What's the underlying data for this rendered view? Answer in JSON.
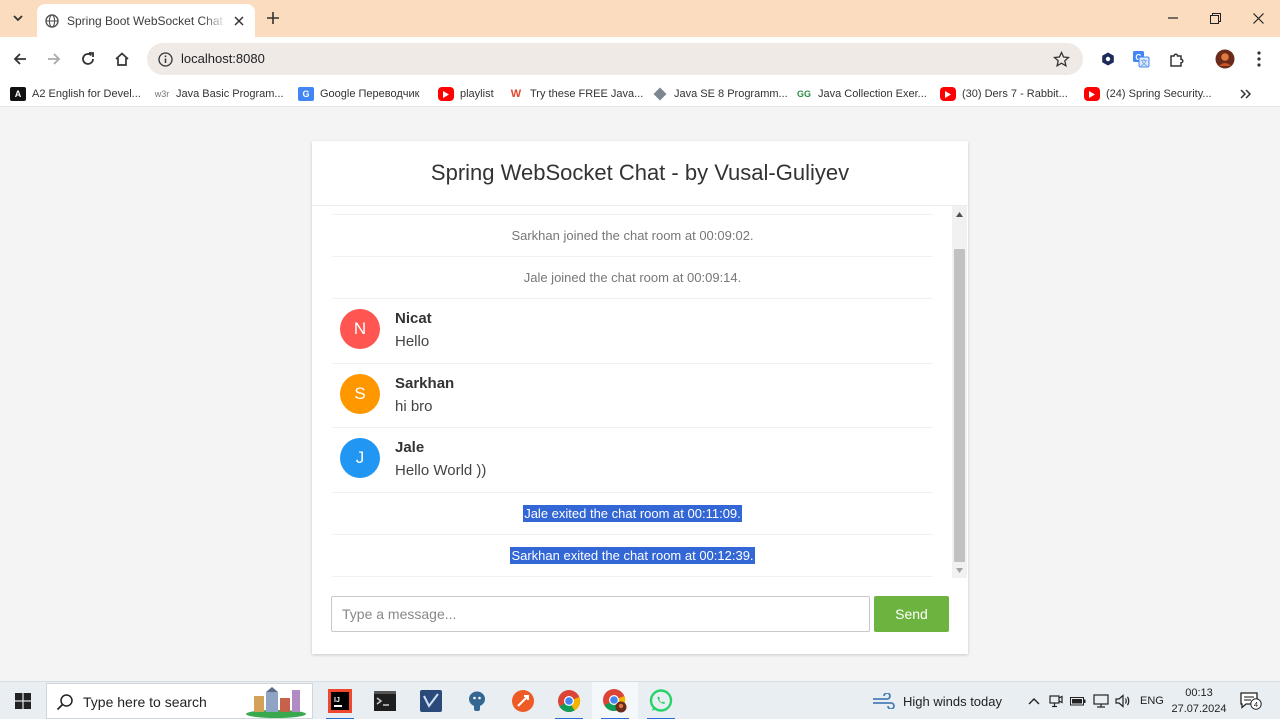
{
  "browser": {
    "tab": {
      "title": "Spring Boot WebSocket Chat Application",
      "favicon": "globe-icon"
    },
    "url": "localhost:8080",
    "bookmarks": [
      {
        "label": "A2 English for Devel...",
        "icon": "a2-icon"
      },
      {
        "label": "Java Basic Program...",
        "icon": "w3r-icon"
      },
      {
        "label": "Google Переводчик",
        "icon": "translate-icon"
      },
      {
        "label": "playlist",
        "icon": "youtube-icon"
      },
      {
        "label": "Try these FREE Java...",
        "icon": "w-logo-icon"
      },
      {
        "label": "Java SE 8 Programm...",
        "icon": "diamond-icon"
      },
      {
        "label": "Java Collection Exer...",
        "icon": "gfg-icon"
      },
      {
        "label": "(30) Ders 7 - Rabbit...",
        "icon": "youtube-icon"
      },
      {
        "label": "(24) Spring Security...",
        "icon": "youtube-icon"
      }
    ]
  },
  "chat": {
    "title": "Spring WebSocket Chat - by Vusal-Guliyev",
    "events_top": [
      "Sarkhan joined the chat room at 00:09:02.",
      "Jale joined the chat room at 00:09:14."
    ],
    "messages": [
      {
        "initial": "N",
        "sender": "Nicat",
        "text": "Hello",
        "color": "#ff5652"
      },
      {
        "initial": "S",
        "sender": "Sarkhan",
        "text": "hi bro",
        "color": "#ff9800"
      },
      {
        "initial": "J",
        "sender": "Jale",
        "text": "Hello World ))",
        "color": "#2196f3"
      }
    ],
    "events_bottom": [
      "Jale exited the chat room at 00:11:09.",
      "Sarkhan exited the chat room at 00:12:39."
    ],
    "input": {
      "placeholder": "Type a message...",
      "value": ""
    },
    "send_label": "Send",
    "send_color": "#6db33f"
  },
  "taskbar": {
    "search_placeholder": "Type here to search",
    "apps": [
      "intellij-icon",
      "terminal-icon",
      "visual-studio-icon",
      "postgresql-icon",
      "postman-icon",
      "chrome-icon",
      "chrome-profile-icon",
      "whatsapp-icon"
    ],
    "weather": "High winds today",
    "language": "ENG",
    "time": "00:13",
    "date": "27.07.2024",
    "notification_count": "4"
  }
}
